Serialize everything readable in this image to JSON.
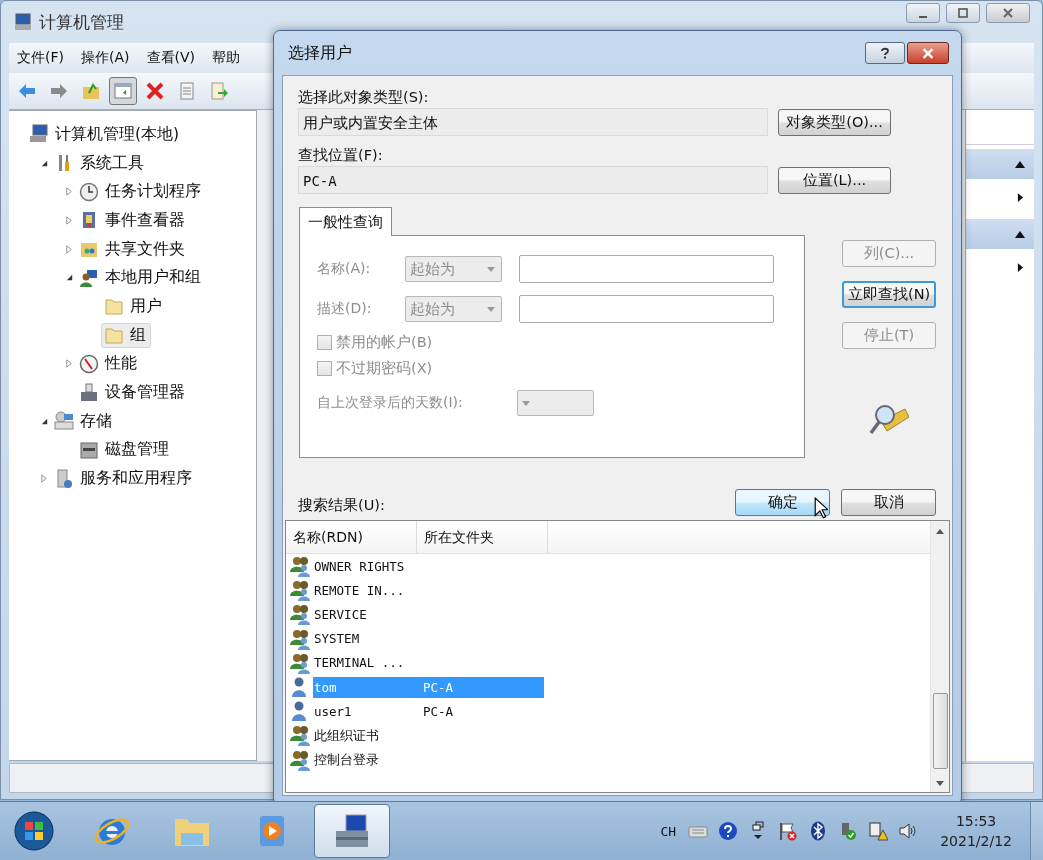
{
  "main_window": {
    "title": "计算机管理",
    "menu": [
      "文件(F)",
      "操作(A)",
      "查看(V)",
      "帮助"
    ],
    "toolbar": [
      {
        "kind": "back",
        "selected": false
      },
      {
        "kind": "forward",
        "selected": false
      },
      {
        "kind": "up",
        "selected": false
      },
      {
        "kind": "tree",
        "selected": true
      },
      {
        "kind": "delete",
        "selected": false
      },
      {
        "kind": "properties",
        "selected": false
      },
      {
        "kind": "export",
        "selected": false
      }
    ],
    "tree": [
      {
        "label": "计算机管理(本地)",
        "kind": "computer",
        "selected": false,
        "children": [
          {
            "label": "系统工具",
            "kind": "tools",
            "expanded": true,
            "selected": false,
            "children": [
              {
                "label": "任务计划程序",
                "kind": "clock",
                "expanded": false,
                "selected": false
              },
              {
                "label": "事件查看器",
                "kind": "event",
                "expanded": false,
                "selected": false
              },
              {
                "label": "共享文件夹",
                "kind": "share",
                "expanded": false,
                "selected": false
              },
              {
                "label": "本地用户和组",
                "kind": "users",
                "expanded": true,
                "selected": false,
                "children": [
                  {
                    "label": "用户",
                    "kind": "folder",
                    "selected": false
                  },
                  {
                    "label": "组",
                    "kind": "folder",
                    "selected": true
                  }
                ]
              },
              {
                "label": "性能",
                "kind": "perf",
                "expanded": false,
                "selected": false
              },
              {
                "label": "设备管理器",
                "kind": "device",
                "selected": false
              }
            ]
          },
          {
            "label": "存储",
            "kind": "storage",
            "expanded": true,
            "selected": false,
            "children": [
              {
                "label": "磁盘管理",
                "kind": "disk",
                "selected": false
              }
            ]
          },
          {
            "label": "服务和应用程序",
            "kind": "services",
            "expanded": false,
            "selected": false
          }
        ]
      }
    ],
    "action_sections": [
      {
        "expanded": true
      },
      {
        "expanded": true
      }
    ]
  },
  "dialog": {
    "title": "选择用户",
    "object_type_label": "选择此对象类型(S):",
    "object_type_value": "用户或内置安全主体",
    "object_type_button": "对象类型(O)...",
    "location_label": "查找位置(F):",
    "location_value": "PC-A",
    "location_button": "位置(L)...",
    "query": {
      "tab": "一般性查询",
      "disabled": true,
      "name_label": "名称(A):",
      "name_mode": "起始为",
      "desc_label": "描述(D):",
      "desc_mode": "起始为",
      "checkboxes": [
        {
          "label": "禁用的帐户(B)",
          "checked": false
        },
        {
          "label": "不过期密码(X)",
          "checked": false
        }
      ],
      "days_label": "自上次登录后的天数(I):"
    },
    "side_buttons": [
      {
        "label": "列(C)...",
        "disabled": true,
        "focused": false
      },
      {
        "label": "立即查找(N)",
        "disabled": false,
        "focused": true
      },
      {
        "label": "停止(T)",
        "disabled": true,
        "focused": false
      }
    ],
    "ok_button": {
      "label": "确定",
      "hovered": true
    },
    "cancel_button": "取消",
    "results_label": "搜索结果(U):",
    "results": {
      "columns": [
        "名称(RDN)",
        "所在文件夹"
      ],
      "rows": [
        {
          "kind": "group",
          "name": "OWNER RIGHTS",
          "selected": false
        },
        {
          "kind": "group",
          "name": "REMOTE IN...",
          "selected": false
        },
        {
          "kind": "group",
          "name": "SERVICE",
          "selected": false
        },
        {
          "kind": "group",
          "name": "SYSTEM",
          "selected": false
        },
        {
          "kind": "group",
          "name": "TERMINAL ...",
          "selected": false
        },
        {
          "kind": "user",
          "name": "tom",
          "folder": "PC-A",
          "selected": true
        },
        {
          "kind": "user",
          "name": "user1",
          "folder": "PC-A",
          "selected": false
        },
        {
          "kind": "group",
          "name": "此组织证书",
          "selected": false
        },
        {
          "kind": "group",
          "name": "控制台登录",
          "selected": false
        }
      ]
    }
  },
  "taskbar": {
    "apps": [
      {
        "kind": "browser",
        "selected": false
      },
      {
        "kind": "folder",
        "selected": false
      },
      {
        "kind": "player",
        "selected": false
      },
      {
        "kind": "toolbox",
        "selected": true
      }
    ],
    "language": "CH",
    "time": "15:53",
    "date": "2021/2/12"
  }
}
